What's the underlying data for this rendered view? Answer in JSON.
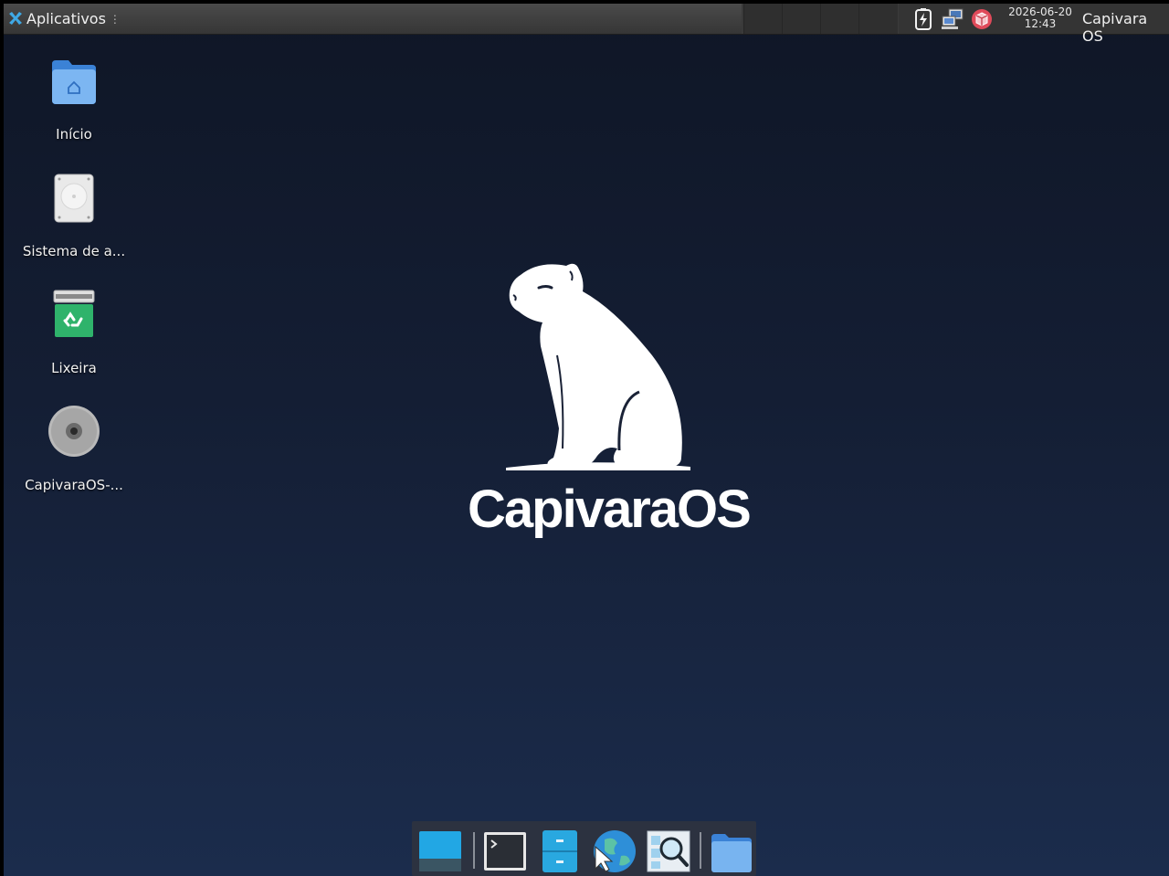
{
  "panel": {
    "app_menu_label": "Aplicativos",
    "grip_glyph": "⋮",
    "clock_date": "2026-06-20",
    "clock_time": "12:43",
    "user_name": "Capivara OS",
    "tray_icons": [
      "battery-charging-icon",
      "network-icon",
      "package-icon"
    ]
  },
  "desktop": {
    "icons": [
      {
        "label": "Início",
        "icon": "home-folder-icon"
      },
      {
        "label": "Sistema de a...",
        "icon": "hard-drive-icon"
      },
      {
        "label": "Lixeira",
        "icon": "trash-icon"
      },
      {
        "label": "CapivaraOS-...",
        "icon": "optical-disc-icon"
      }
    ]
  },
  "wallpaper": {
    "brand_text": "CapivaraOS",
    "logo_icon": "capybara-logo-icon"
  },
  "dock": {
    "items": [
      "show-desktop-icon",
      "terminal-icon",
      "file-cabinet-icon",
      "web-browser-icon",
      "app-finder-icon",
      "folder-icon"
    ]
  },
  "colors": {
    "panel": "#3a3a3a",
    "desktop_top": "#0f1626",
    "desktop_bottom": "#1b2c4c",
    "accent": "#2aa6e0"
  }
}
